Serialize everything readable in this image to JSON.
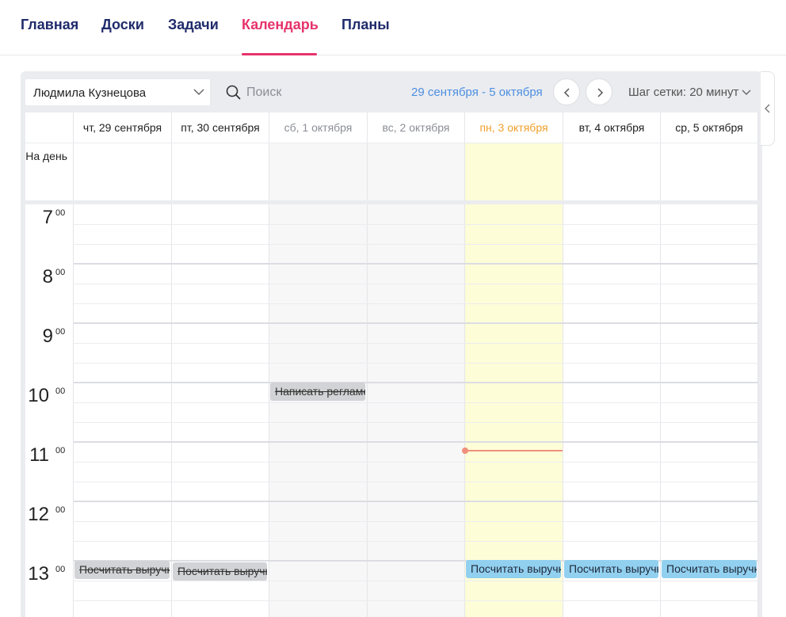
{
  "nav": {
    "tabs": [
      {
        "label": "Главная"
      },
      {
        "label": "Доски"
      },
      {
        "label": "Задачи"
      },
      {
        "label": "Календарь",
        "active": true
      },
      {
        "label": "Планы"
      }
    ]
  },
  "toolbar": {
    "user": "Людмила Кузнецова",
    "search_placeholder": "Поиск",
    "date_range": "29 сентября - 5 октября",
    "grid_step": "Шаг сетки: 20 минут"
  },
  "calendar": {
    "allday_label": "На день",
    "days": [
      {
        "label": "чт, 29 сентября",
        "kind": "weekday"
      },
      {
        "label": "пт, 30 сентября",
        "kind": "weekday"
      },
      {
        "label": "сб, 1 октября",
        "kind": "weekend"
      },
      {
        "label": "вс, 2 октября",
        "kind": "weekend"
      },
      {
        "label": "пн, 3 октября",
        "kind": "today"
      },
      {
        "label": "вт, 4 октября",
        "kind": "weekday"
      },
      {
        "label": "ср, 5 октября",
        "kind": "weekday"
      }
    ],
    "hours": [
      "7",
      "8",
      "9",
      "10",
      "11",
      "12",
      "13"
    ],
    "minutes_label": "00",
    "events": [
      {
        "day": 2,
        "title": "Написать регламент",
        "status": "done"
      },
      {
        "day": 0,
        "title": "Посчитать выручку",
        "status": "done"
      },
      {
        "day": 1,
        "title": "Посчитать выручку",
        "status": "done"
      },
      {
        "day": 4,
        "title": "Посчитать выручку",
        "status": "active"
      },
      {
        "day": 5,
        "title": "Посчитать выручку",
        "status": "active"
      },
      {
        "day": 6,
        "title": "Посчитать выручку",
        "status": "active"
      }
    ]
  },
  "colors": {
    "accent": "#e6336b",
    "nav_text": "#1f2b6b",
    "today_header": "#f0a02c",
    "today_bg": "#fdfdd8",
    "event_active": "#92d0f0",
    "event_done": "#d2d3d6",
    "now_line": "#f0907c",
    "date_range": "#4d8fe0"
  }
}
